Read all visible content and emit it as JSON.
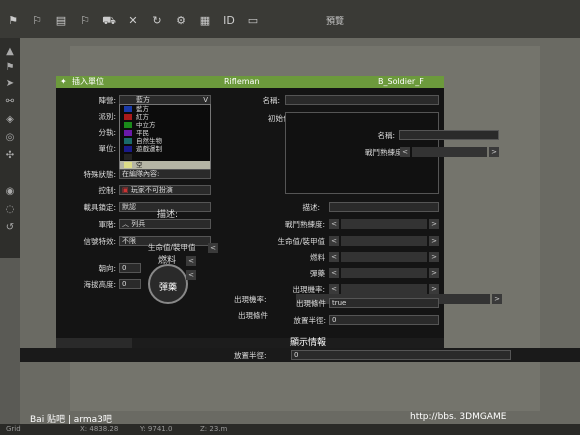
{
  "toolbar": {
    "preview": "預覽",
    "id": "ID"
  },
  "dialog": {
    "title": "插入單位",
    "class": "Rifleman",
    "callsign": "B_Soldier_F",
    "left_labels": {
      "side": "陣營:",
      "faction": "派別:",
      "group": "分執:",
      "unit": "單位:",
      "special_state": "特殊狀態:",
      "control": "控制:",
      "vehicle_lock": "載具鎖定:",
      "rank": "軍階:",
      "info_age": "信號特效:",
      "direction": "朝向:",
      "height": "海拔高度:"
    },
    "left_values": {
      "side": "藍方",
      "special_state": "在編隊內容:",
      "control": "玩家不可扮演",
      "vehicle_lock": "默認",
      "rank": "列兵",
      "info_age": "不限",
      "direction": "0",
      "height": "0"
    },
    "side_options": [
      "藍方",
      "紅方",
      "中立方",
      "平民",
      "自然生物",
      "遊戲運制",
      "空"
    ],
    "side_colors": [
      "#1a3aa8",
      "#a81a1a",
      "#1a8a1a",
      "#6a1aa8",
      "#1a6a6a",
      "#1a1a8a",
      "#dddd88"
    ],
    "right_labels": {
      "name": "名稱:",
      "init": "初始化內容:",
      "name2": "名稱:",
      "skill": "戰鬥熟練度:",
      "desc": "描述:",
      "skill2": "戰鬥熟練度:",
      "health": "生命值/裝甲值",
      "fuel": "燃料",
      "ammo": "彈藥",
      "probability": "出現機率:",
      "condition": "出現條件",
      "placement": "放置半徑:"
    },
    "overlay_labels": {
      "desc": "描述:",
      "health": "生命值/裝甲值",
      "fuel": "燃料",
      "ammo": "彈藥",
      "probability": "出現機率:",
      "condition": "出現條件"
    },
    "condition_value": "true",
    "placement_value": "0",
    "show_info": "顯示情報",
    "bottom_placement_label": "放置半徑:",
    "bottom_placement_value": "0",
    "arrow_left": "<",
    "arrow_right": ">",
    "dropdown_arrow": "V"
  },
  "status": {
    "grid": "Grid",
    "x": "X: 4838.28",
    "y": "Y: 9741.0",
    "z": "Z: 23.m"
  },
  "watermarks": {
    "left": "Bai 贴吧 | arma3吧",
    "right": "http://bbs. 3DMGAME"
  }
}
